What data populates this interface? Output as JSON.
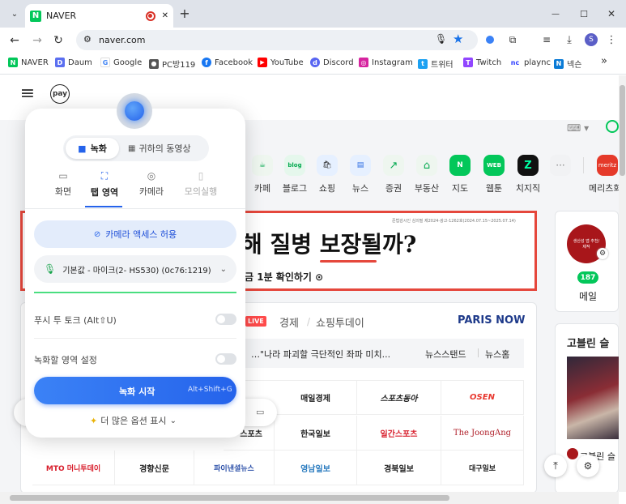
{
  "browser": {
    "tab_title": "NAVER",
    "new_tab": "+",
    "url": "naver.com",
    "profile_initial": "S",
    "favicon_letter": "N"
  },
  "window": {
    "minimize": "—",
    "maximize": "☐",
    "close": "✕"
  },
  "bookmarks": [
    {
      "label": "NAVER",
      "icon": "N",
      "color": "#03c75a"
    },
    {
      "label": "Daum",
      "icon": "D",
      "color": "#5b6ff0"
    },
    {
      "label": "Google",
      "icon": "G",
      "color": "#4285f4"
    },
    {
      "label": "PC방119",
      "icon": "●",
      "color": "#555555"
    },
    {
      "label": "Facebook",
      "icon": "f",
      "color": "#1877f2"
    },
    {
      "label": "YouTube",
      "icon": "▶",
      "color": "#ff0000"
    },
    {
      "label": "Discord",
      "icon": "d",
      "color": "#5865f2"
    },
    {
      "label": "Instagram",
      "icon": "◎",
      "color": "#d6249f"
    },
    {
      "label": "트위터",
      "icon": "t",
      "color": "#1da1f2"
    },
    {
      "label": "Twitch",
      "icon": "T",
      "color": "#9146ff"
    },
    {
      "label": "plaync",
      "icon": "nc",
      "color": "#2d3dff"
    },
    {
      "label": "넥슨",
      "icon": "N",
      "color": "#0b7bd6"
    }
  ],
  "bookmarks_more": "»",
  "naver": {
    "pay_label": "pay",
    "services": [
      "카페",
      "블로그",
      "쇼핑",
      "뉴스",
      "증권",
      "부동산",
      "지도",
      "웹툰",
      "치지직",
      "메리츠화"
    ],
    "service_icon_text": [
      "☕",
      "blog",
      "🛍",
      "▤",
      "↗",
      "⌂",
      "N",
      "WEB",
      "Z",
      "meritz"
    ],
    "more_dots": "···",
    "ad_headline": "해 질병 보장될까?",
    "ad_sub": "금 1분 확인하기 ⊙",
    "ad_fineprint": "준법감시인 심의필 제2024-광고-1262호(2024.07.15~2025.07.14)",
    "news_tabs": [
      "LIVE",
      "경제",
      "쇼핑투데이"
    ],
    "paris_now": "PARIS NOW",
    "headline": "…\"나라 파괴할 극단적인 좌파 미치...",
    "newsstand": "뉴스스탠드",
    "newshome": "뉴스홈",
    "press": [
      "매일경제",
      "스포츠동아",
      "OSEN",
      "한국일보",
      "일간스포츠",
      "The JoongAng",
      "MTO 머니투데이",
      "경향신문",
      "파이낸셜뉴스",
      "영남일보",
      "경북일보",
      "대구일보"
    ],
    "press_left_cut": "스포츠",
    "mail_count": "187",
    "mail_label": "메일",
    "right_title": "고블린 슬",
    "right_caption": "고블린 슬",
    "profile_badge": "생산성 앱 추천/제작"
  },
  "recorder": {
    "mode_record": "녹화",
    "mode_video": "귀하의 동영상",
    "sources": [
      "화면",
      "탭 영역",
      "카메라",
      "모의실행"
    ],
    "camera_permission": "카메라 액세스 허용",
    "mic_value": "기본값 - 마이크(2- HS530) (0c76:1219)",
    "push_to_talk": "푸시 투 토크 (Alt⇧U)",
    "record_area": "녹화할 영역 설정",
    "start": "녹화 시작",
    "shortcut": "Alt+Shift+G",
    "more_options": "더 많은 옵션 표시",
    "accent": "#3b82f6"
  }
}
